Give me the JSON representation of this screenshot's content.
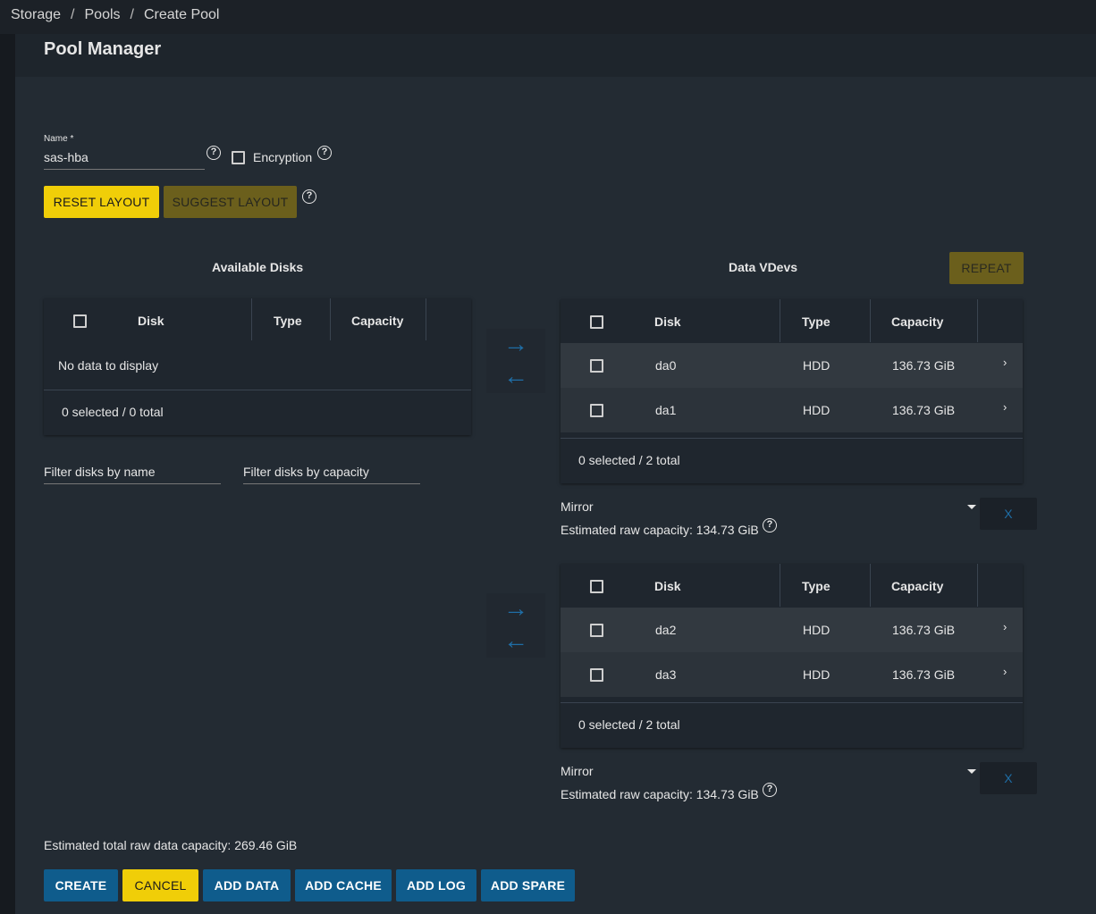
{
  "breadcrumb": [
    "Storage",
    "Pools",
    "Create Pool"
  ],
  "page_title": "Pool Manager",
  "name_field": {
    "label": "Name *",
    "value": "sas-hba"
  },
  "encryption_label": "Encryption",
  "buttons": {
    "reset_layout": "RESET LAYOUT",
    "suggest_layout": "SUGGEST LAYOUT",
    "repeat": "REPEAT",
    "create": "CREATE",
    "cancel": "CANCEL",
    "add_data": "ADD DATA",
    "add_cache": "ADD CACHE",
    "add_log": "ADD LOG",
    "add_spare": "ADD SPARE",
    "remove_vdev": "X"
  },
  "available_disks": {
    "title": "Available Disks",
    "columns": [
      "Disk",
      "Type",
      "Capacity"
    ],
    "empty_text": "No data to display",
    "footer": "0 selected / 0 total",
    "filter_name_placeholder": "Filter disks by name",
    "filter_capacity_placeholder": "Filter disks by capacity"
  },
  "data_vdevs": {
    "title": "Data VDevs",
    "vdevs": [
      {
        "columns": [
          "Disk",
          "Type",
          "Capacity"
        ],
        "rows": [
          {
            "disk": "da0",
            "type": "HDD",
            "capacity": "136.73 GiB"
          },
          {
            "disk": "da1",
            "type": "HDD",
            "capacity": "136.73 GiB"
          }
        ],
        "footer": "0 selected / 2 total",
        "layout": "Mirror",
        "estimated": "Estimated raw capacity: 134.73 GiB"
      },
      {
        "columns": [
          "Disk",
          "Type",
          "Capacity"
        ],
        "rows": [
          {
            "disk": "da2",
            "type": "HDD",
            "capacity": "136.73 GiB"
          },
          {
            "disk": "da3",
            "type": "HDD",
            "capacity": "136.73 GiB"
          }
        ],
        "footer": "0 selected / 2 total",
        "layout": "Mirror",
        "estimated": "Estimated raw capacity: 134.73 GiB"
      }
    ]
  },
  "total_estimate": "Estimated total raw data capacity: 269.46 GiB",
  "icons": {
    "help": "?",
    "move_right": "→",
    "move_left": "←",
    "chevron": "›"
  },
  "colors": {
    "accent_yellow": "#f0ce08",
    "primary_blue": "#0f5c8c",
    "background": "#232b33"
  }
}
